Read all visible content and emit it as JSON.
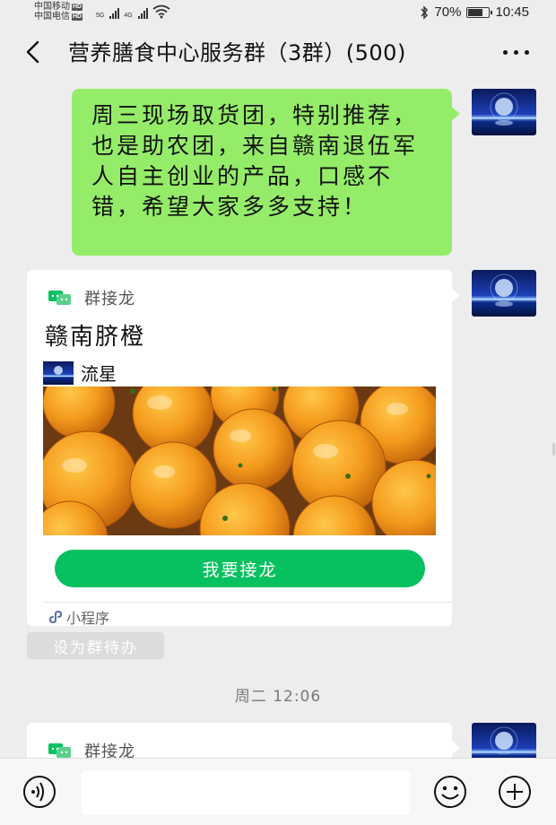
{
  "status_bar": {
    "carrier_1": "中国移动",
    "carrier_2": "中国电信",
    "hd_badge": "HD",
    "net_1": "5G",
    "net_2": "4G",
    "battery_percent": "70%",
    "battery_level": 0.7,
    "time": "10:45"
  },
  "header": {
    "title": "营养膳食中心服务群（3群）(500)",
    "back_icon": "chevron-left-icon",
    "more_icon": "more-dots-icon"
  },
  "messages": {
    "text_message": "周三现场取货团，特别推荐，也是助农团，来自赣南退伍军人自主创业的产品，口感不错，希望大家多多支持！",
    "card": {
      "source": "群接龙",
      "title": "赣南脐橙",
      "creator_name": "流星",
      "button_label": "我要接龙",
      "mini_program_label": "小程序"
    },
    "todo_label": "设为群待办",
    "timestamp": "周二 12:06",
    "card_2": {
      "source": "群接龙"
    }
  },
  "input_bar": {
    "placeholder": "",
    "voice_icon": "voice-icon",
    "emoji_icon": "emoji-icon",
    "plus_icon": "plus-icon"
  },
  "colors": {
    "bubble_green": "#95ec69",
    "button_green": "#07c160",
    "background": "#ededed"
  }
}
